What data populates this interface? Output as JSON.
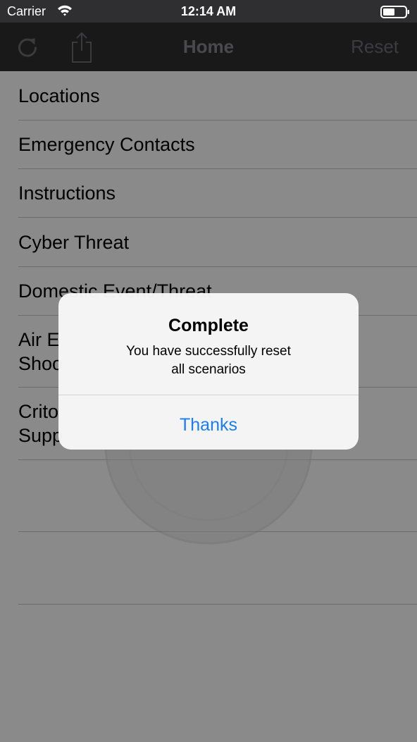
{
  "status_bar": {
    "carrier": "Carrier",
    "time": "12:14 AM"
  },
  "nav": {
    "title": "Home",
    "reset_label": "Reset",
    "left_icons": [
      "refresh-icon",
      "share-icon"
    ]
  },
  "menu": {
    "items": [
      {
        "label": "Locations"
      },
      {
        "label": "Emergency Contacts"
      },
      {
        "label": "Instructions"
      },
      {
        "label": "Cyber Threat"
      },
      {
        "label": "Domestic Event/Threat"
      },
      {
        "label": "Air E\nShoo"
      },
      {
        "label": "Crito\nSupp"
      }
    ]
  },
  "alert": {
    "title": "Complete",
    "message": "You have successfully reset\nall scenarios",
    "action_label": "Thanks"
  },
  "colors": {
    "nav_background": "#2f2f31",
    "dim_overlay": "rgba(0,0,0,0.46)",
    "alert_action": "#1a7df2"
  }
}
